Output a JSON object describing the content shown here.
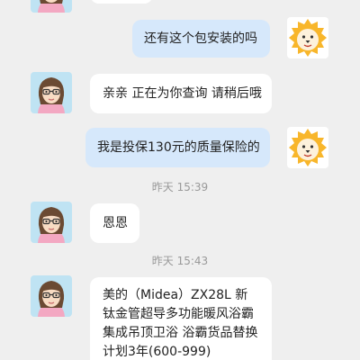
{
  "messages": [
    {
      "from": "agent",
      "text": ""
    },
    {
      "from": "user",
      "text": "还有这个包安装的吗"
    },
    {
      "from": "agent",
      "text": "亲亲 正在为你查询 请稍后哦"
    },
    {
      "from": "user",
      "text": "我是投保130元的质量保险的"
    },
    {
      "timestamp": "昨天 15:39"
    },
    {
      "from": "agent",
      "text": "恩恩"
    },
    {
      "timestamp": "昨天 15:43"
    },
    {
      "from": "agent",
      "text": "美的（Midea）ZX28L 新钛金管超导多功能暖风浴霸 集成吊顶卫浴 浴霸货品替换计划3年(600-999)"
    }
  ],
  "icons": {
    "agent_avatar": "girl-with-glasses-avatar",
    "user_avatar": "lion-mascot-avatar"
  },
  "colors": {
    "background": "#efefef",
    "incoming_bubble": "#ffffff",
    "outgoing_bubble": "#d6e8fb",
    "timestamp_text": "#999999"
  }
}
